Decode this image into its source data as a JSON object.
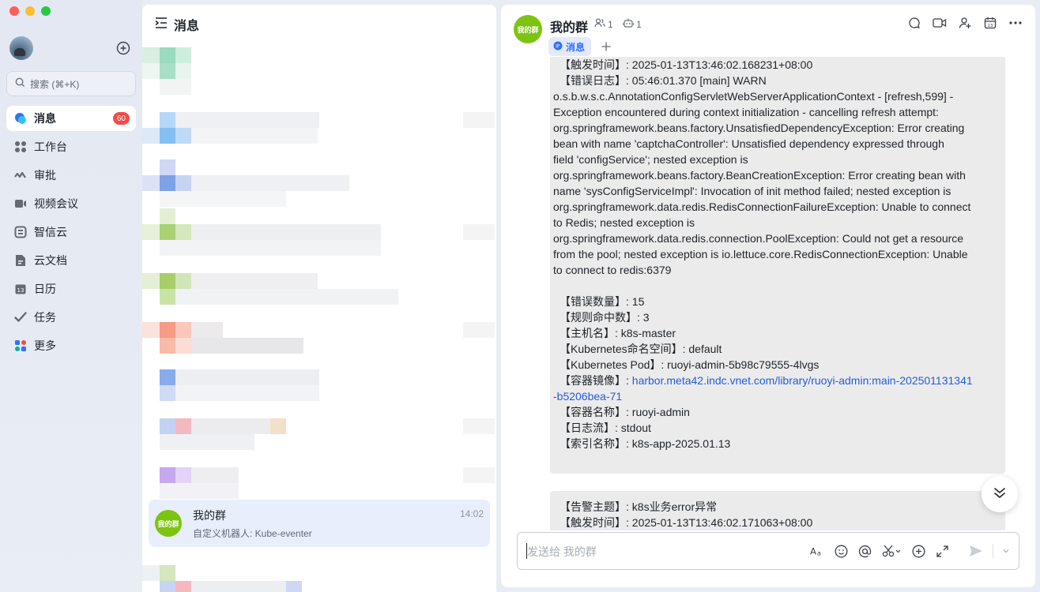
{
  "sidebar": {
    "search_placeholder": "搜索 (⌘+K)",
    "items": [
      {
        "label": "消息",
        "icon": "chat-bubble-icon",
        "badge": "60",
        "active": true
      },
      {
        "label": "工作台",
        "icon": "grid-icon"
      },
      {
        "label": "审批",
        "icon": "approval-icon"
      },
      {
        "label": "视频会议",
        "icon": "video-icon"
      },
      {
        "label": "智信云",
        "icon": "cloud-icon"
      },
      {
        "label": "云文档",
        "icon": "docs-icon"
      },
      {
        "label": "日历",
        "icon": "calendar-icon"
      },
      {
        "label": "任务",
        "icon": "task-check-icon"
      },
      {
        "label": "更多",
        "icon": "more-apps-icon"
      }
    ]
  },
  "chat_list": {
    "title": "消息",
    "selected_chat": {
      "avatar_text": "我的群",
      "name": "我的群",
      "time": "14:02",
      "preview": "自定义机器人: Kube-eventer"
    }
  },
  "chat": {
    "title": "我的群",
    "avatar_text": "我的群",
    "member_count": "1",
    "bot_count": "1",
    "tab_label": "消息",
    "composer_placeholder": "发送给 我的群",
    "message1": {
      "trigger_time": "【触发时间】: 2025-01-13T13:46:02.168231+08:00",
      "error_log_head": "【错误日志】: 05:46:01.370 [main] WARN",
      "error_log_lines": [
        "o.s.b.w.s.c.AnnotationConfigServletWebServerApplicationContext - [refresh,599] -",
        "Exception encountered during context initialization - cancelling refresh attempt:",
        "org.springframework.beans.factory.UnsatisfiedDependencyException: Error creating",
        "bean with name 'captchaController': Unsatisfied dependency expressed through",
        "field 'configService'; nested exception is",
        "org.springframework.beans.factory.BeanCreationException: Error creating bean with",
        "name 'sysConfigServiceImpl': Invocation of init method failed; nested exception is",
        "org.springframework.data.redis.RedisConnectionFailureException: Unable to connect",
        "to Redis; nested exception is",
        "org.springframework.data.redis.connection.PoolException: Could not get a resource",
        "from the pool; nested exception is io.lettuce.core.RedisConnectionException: Unable",
        "to connect to redis:6379"
      ],
      "error_count": "【错误数量】: 15",
      "rule_hits": "【规则命中数】: 3",
      "hostname": "【主机名】: k8s-master",
      "namespace": "【Kubernetes命名空间】: default",
      "pod": "【Kubernetes Pod】: ruoyi-admin-5b98c79555-4lvgs",
      "image_label": "【容器镜像】: ",
      "image_link_line1": "harbor.meta42.indc.vnet.com/library/ruoyi-admin:main-202501131341",
      "image_link_line2": "-b5206bea-71",
      "container_name": "【容器名称】: ruoyi-admin",
      "log_stream": "【日志流】: stdout",
      "index_name": "【索引名称】: k8s-app-2025.01.13"
    },
    "message2": {
      "subject": "【告警主题】: k8s业务error异常",
      "trigger_time": "【触发时间】: 2025-01-13T13:46:02.171063+08:00"
    }
  },
  "colors": {
    "accent": "#3370ff",
    "badge": "#f54a45",
    "group_avatar": "#7cc40f",
    "link": "#245bdb"
  }
}
